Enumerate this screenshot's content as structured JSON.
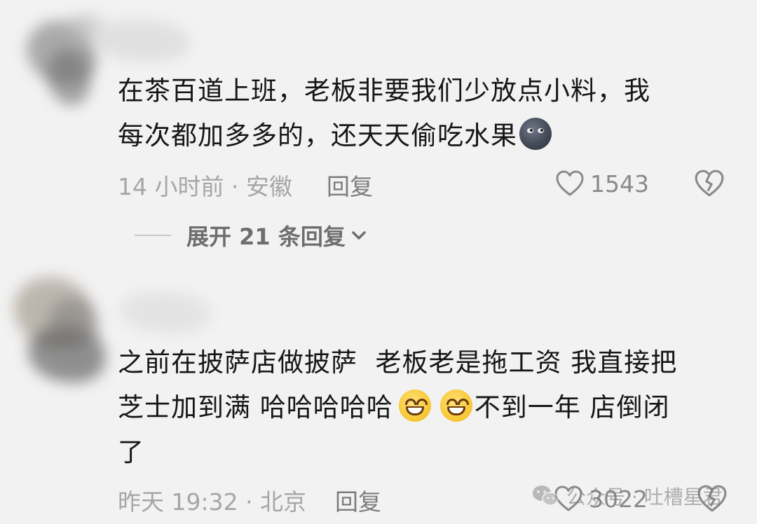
{
  "comments": [
    {
      "text_lines": [
        "在茶百道上班，老板非要我们少放点小料，我",
        "每次都加多多的，还天天偷吃水果"
      ],
      "emoji_after": "new-moon-face",
      "meta": "14 小时前 · 安徽",
      "reply_label": "回复",
      "likes": "1543",
      "expand_label": "展开 21 条回复"
    },
    {
      "text_lines": [
        "之前在披萨店做披萨  老板老是拖工资 我直接把",
        "芝士加到满 哈哈哈哈哈",
        "不到一年 店倒闭",
        "了"
      ],
      "emoji_inline": "grinning-face-with-smiling-eyes",
      "meta": "昨天 19:32 · 北京",
      "reply_label": "回复",
      "likes": "3022"
    }
  ],
  "watermark": {
    "text": "公众号 · 吐槽星君",
    "icon": "wechat-icon"
  },
  "colors": {
    "background": "#f2f2f2",
    "text": "#161616",
    "meta": "#a6a6a6",
    "icon": "#8a8a8a"
  }
}
